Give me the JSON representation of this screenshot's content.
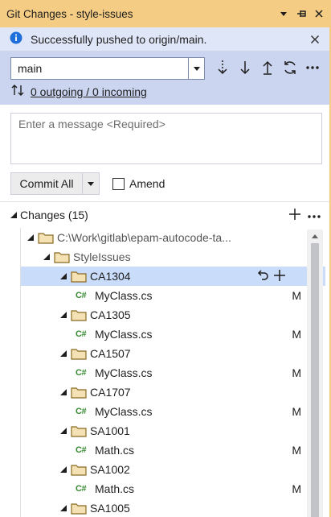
{
  "window": {
    "title": "Git Changes - style-issues"
  },
  "notification": {
    "message": "Successfully pushed to origin/main."
  },
  "branch": {
    "selected": "main",
    "sync_status": "0 outgoing / 0 incoming"
  },
  "commit": {
    "message_placeholder": "Enter a message <Required>",
    "commit_button": "Commit All",
    "amend_label": "Amend",
    "amend_checked": false
  },
  "changes": {
    "header": "Changes (15)",
    "tree": [
      {
        "label": "C:\\Work\\gitlab\\epam-autocode-ta...",
        "kind": "folder",
        "level": 0
      },
      {
        "label": "StyleIssues",
        "kind": "folder",
        "level": 1
      },
      {
        "label": "CA1304",
        "kind": "folder",
        "level": 2,
        "selected": true
      },
      {
        "label": "MyClass.cs",
        "kind": "file",
        "level": 3,
        "status": "M"
      },
      {
        "label": "CA1305",
        "kind": "folder",
        "level": 2
      },
      {
        "label": "MyClass.cs",
        "kind": "file",
        "level": 3,
        "status": "M"
      },
      {
        "label": "CA1507",
        "kind": "folder",
        "level": 2
      },
      {
        "label": "MyClass.cs",
        "kind": "file",
        "level": 3,
        "status": "M"
      },
      {
        "label": "CA1707",
        "kind": "folder",
        "level": 2
      },
      {
        "label": "MyClass.cs",
        "kind": "file",
        "level": 3,
        "status": "M"
      },
      {
        "label": "SA1001",
        "kind": "folder",
        "level": 2
      },
      {
        "label": "Math.cs",
        "kind": "file",
        "level": 3,
        "status": "M"
      },
      {
        "label": "SA1002",
        "kind": "folder",
        "level": 2
      },
      {
        "label": "Math.cs",
        "kind": "file",
        "level": 3,
        "status": "M"
      },
      {
        "label": "SA1005",
        "kind": "folder",
        "level": 2
      }
    ],
    "file_icon_text": "C#"
  },
  "colors": {
    "title_bar": "#f5cc84",
    "info_bar": "#dfe6f7",
    "branch_panel": "#ccd5f0",
    "selection": "#c9dcf9",
    "info_icon": "#1e6fd9",
    "csharp_icon": "#388a34"
  },
  "icons": [
    "dropdown-icon",
    "pin-icon",
    "close-icon",
    "info-icon",
    "fetch-icon",
    "pull-icon",
    "push-icon",
    "sync-icon",
    "more-icon",
    "arrows-updown-icon",
    "chevron-down-icon",
    "folder-icon",
    "csharp-file-icon",
    "undo-icon",
    "plus-icon"
  ]
}
